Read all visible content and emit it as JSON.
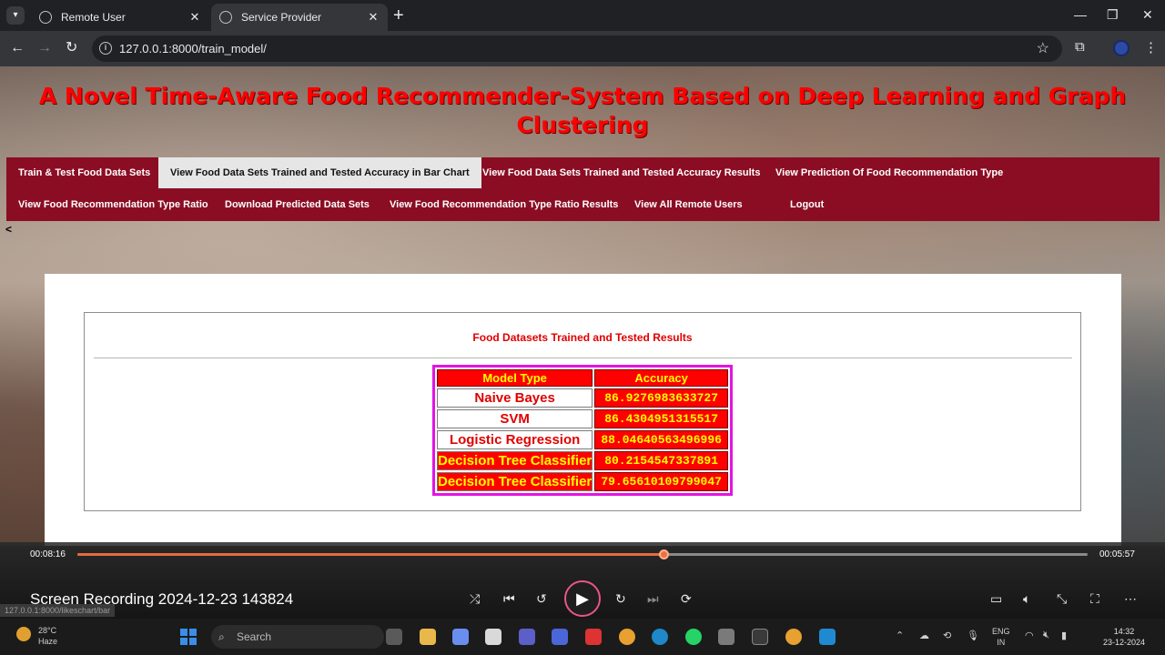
{
  "browser": {
    "tabs": [
      {
        "label": "Remote User",
        "active": false
      },
      {
        "label": "Service Provider",
        "active": true
      }
    ],
    "url": "127.0.0.1:8000/train_model/"
  },
  "site": {
    "title": "A Novel Time-Aware Food Recommender-System Based on Deep Learning and Graph Clustering",
    "title_color": "#ff0000",
    "nav_color": "#8b0d24",
    "menu": [
      {
        "label": "Train & Test Food Data Sets",
        "active": false
      },
      {
        "label": "View Food Data Sets Trained and Tested Accuracy in Bar Chart",
        "active": true
      },
      {
        "label": "View Food Data Sets Trained and Tested Accuracy Results",
        "active": false
      },
      {
        "label": "View Prediction Of Food Recommendation Type",
        "active": false
      },
      {
        "label": "View Food Recommendation Type Ratio",
        "active": false
      },
      {
        "label": "Download Predicted Data Sets",
        "active": false
      },
      {
        "label": "View Food Recommendation Type Ratio Results",
        "active": false
      },
      {
        "label": "View All Remote Users",
        "active": false
      },
      {
        "label": "Logout",
        "active": false
      }
    ],
    "back_link": "<"
  },
  "results": {
    "title": "Food Datasets Trained and Tested Results",
    "headers": [
      "Model Type",
      "Accuracy"
    ],
    "rows": [
      {
        "model": "Naive Bayes",
        "accuracy": "86.9276983633727"
      },
      {
        "model": "SVM",
        "accuracy": "86.4304951315517"
      },
      {
        "model": "Logistic Regression",
        "accuracy": "88.04640563496996"
      },
      {
        "model": "Decision Tree Classifier",
        "accuracy": "80.2154547337891"
      },
      {
        "model": "Decision Tree Classifier",
        "accuracy": "79.65610109799047"
      }
    ]
  },
  "player": {
    "elapsed": "00:08:16",
    "remaining": "00:05:57",
    "progress": 0.58,
    "title": "Screen Recording 2024-12-23 143824",
    "accent": "#e86a3a"
  },
  "status_url": "127.0.0.1:8000/likeschart/bar",
  "taskbar": {
    "weather_temp": "28°C",
    "weather_desc": "Haze",
    "search_placeholder": "Search",
    "lang_1": "ENG",
    "lang_2": "IN",
    "time": "14:32",
    "date": "23-12-2024"
  }
}
